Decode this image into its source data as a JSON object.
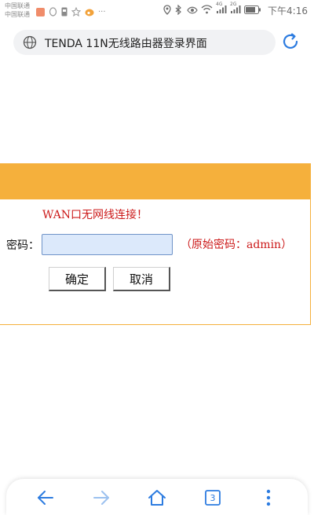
{
  "status_bar": {
    "carrier_line1": "中国联通",
    "carrier_line2": "中国联通",
    "more_indicator": "···",
    "time": "下午4:16",
    "signal1_label": "4G",
    "signal2_label": "2G"
  },
  "browser": {
    "url_title": "TENDA 11N无线路由器登录界面",
    "tab_count": "3"
  },
  "login": {
    "warning": "WAN口无网线连接！",
    "password_label": "密码：",
    "password_value": "",
    "hint": "（原始密码：admin）",
    "ok_label": "确定",
    "cancel_label": "取消"
  },
  "colors": {
    "header_orange": "#f5b03c",
    "warning_red": "#cc1a1a",
    "input_bg": "#dce9fb",
    "accent_blue": "#2d7ce0"
  }
}
